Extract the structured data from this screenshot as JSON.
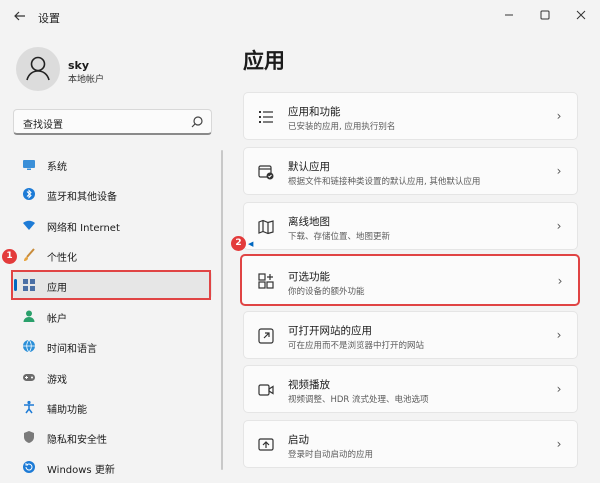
{
  "window": {
    "title": "设置",
    "back_icon": "arrow-left-icon",
    "controls": [
      "minimize-icon",
      "maximize-icon",
      "close-icon"
    ]
  },
  "user": {
    "name": "sky",
    "account_type": "本地帐户"
  },
  "search": {
    "placeholder": "查找设置"
  },
  "sidebar": {
    "items": [
      {
        "label": "系统",
        "icon": "display-icon"
      },
      {
        "label": "蓝牙和其他设备",
        "icon": "bluetooth-icon"
      },
      {
        "label": "网络和 Internet",
        "icon": "wifi-icon"
      },
      {
        "label": "个性化",
        "icon": "brush-icon"
      },
      {
        "label": "应用",
        "icon": "apps-icon",
        "selected": true
      },
      {
        "label": "帐户",
        "icon": "person-icon"
      },
      {
        "label": "时间和语言",
        "icon": "globe-icon"
      },
      {
        "label": "游戏",
        "icon": "gamepad-icon"
      },
      {
        "label": "辅助功能",
        "icon": "accessibility-icon"
      },
      {
        "label": "隐私和安全性",
        "icon": "shield-icon"
      },
      {
        "label": "Windows 更新",
        "icon": "update-icon"
      }
    ]
  },
  "annotations": {
    "badge_1": "1",
    "badge_2": "2",
    "highlight_color": "#e04444"
  },
  "main": {
    "title": "应用",
    "cards": [
      {
        "title": "应用和功能",
        "desc": "已安装的应用, 应用执行别名",
        "icon": "list-icon"
      },
      {
        "title": "默认应用",
        "desc": "根据文件和链接种类设置的默认应用, 其他默认应用",
        "icon": "default-apps-icon"
      },
      {
        "title": "离线地图",
        "desc": "下载、存储位置、地图更新",
        "icon": "map-icon"
      },
      {
        "title": "可选功能",
        "desc": "你的设备的额外功能",
        "icon": "optional-features-icon",
        "highlighted": true
      },
      {
        "title": "可打开网站的应用",
        "desc": "可在应用而不是浏览器中打开的网站",
        "icon": "open-link-icon"
      },
      {
        "title": "视频播放",
        "desc": "视频调整、HDR 流式处理、电池选项",
        "icon": "video-icon"
      },
      {
        "title": "启动",
        "desc": "登录时自动启动的应用",
        "icon": "startup-icon"
      }
    ]
  },
  "colors": {
    "accent": "#0067c0",
    "annotation_red": "#e04444"
  }
}
